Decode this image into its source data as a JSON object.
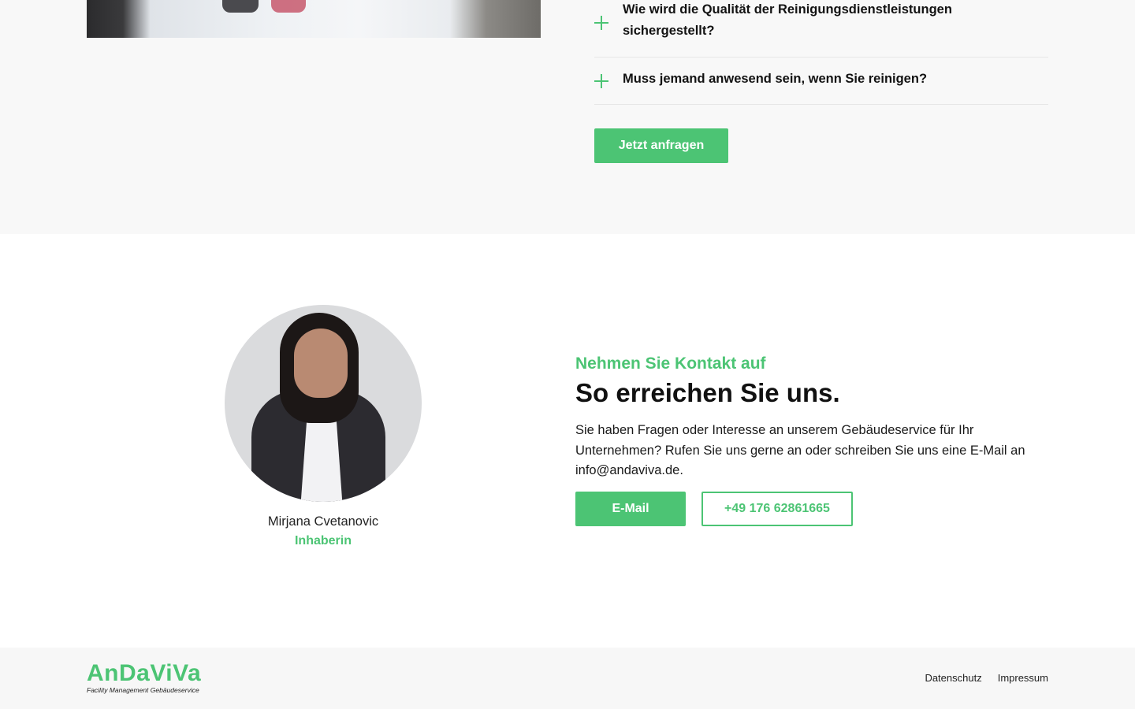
{
  "faq": {
    "items": [
      {
        "question": "Wie wird die Qualität der Reinigungsdienstleistungen sichergestellt?"
      },
      {
        "question": "Muss jemand anwesend sein, wenn Sie reinigen?"
      }
    ],
    "cta_label": "Jetzt anfragen"
  },
  "contact": {
    "person_name": "Mirjana Cvetanovic",
    "person_role": "Inhaberin",
    "kicker": "Nehmen Sie Kontakt auf",
    "heading": "So erreichen Sie uns.",
    "text": "Sie haben Fragen oder Interesse an unserem Gebäudeservice für Ihr Unternehmen? Rufen Sie uns gerne an oder schreiben Sie uns eine E-Mail an info@andaviva.de.",
    "email_button": "E-Mail",
    "phone_button": "+49 176 62861665"
  },
  "footer": {
    "logo_name": "AnDaViVa",
    "logo_tagline": "Facility Management Gebäudeservice",
    "links": [
      "Datenschutz",
      "Impressum"
    ]
  },
  "colors": {
    "accent": "#4cc474",
    "section_bg": "#f8f8f8",
    "text": "#111111"
  },
  "icons": [
    "plus-icon"
  ]
}
